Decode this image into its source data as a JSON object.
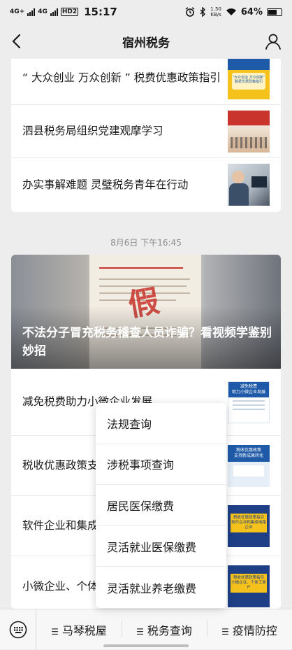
{
  "status": {
    "signal1": "4G+",
    "signal2": "4G",
    "hd": "HD2",
    "time": "15:17",
    "speed_value": "1.50",
    "speed_unit": "KB/s",
    "battery": "64%"
  },
  "header": {
    "title": "宿州税务"
  },
  "top_articles": [
    {
      "title": "“ 大众创业 万众创新 ” 税费优惠政策指引",
      "thumb_caption": "“大众创业 万众创新” 税费优惠政策指引"
    },
    {
      "title": "泗县税务局组织党建观摩学习"
    },
    {
      "title": "办实事解难题 灵璧税务青年在行动"
    }
  ],
  "timestamp": "8月6日 下午16:45",
  "cover": {
    "headline": "不法分子冒充税务稽查人员诈骗？看视频学鉴别妙招",
    "stamp": "假"
  },
  "articles": [
    {
      "title": "减免税费助力小微企业发展",
      "thumb_title": "减免税费",
      "thumb_sub": "助力小微企业发展"
    },
    {
      "title": "税收优惠政策支",
      "thumb_title": "税收优惠政策",
      "thumb_sub": "支持新成果转化"
    },
    {
      "title": "软件企业和集成指引",
      "thumb_title": "税收优惠政策指引",
      "thumb_sub": "软件企业和集成电路企业"
    },
    {
      "title": "小微企业、个体引",
      "thumb_title": "税收优惠政策指引",
      "thumb_sub": "小微企业、个体工商户"
    }
  ],
  "popup_menu": [
    "法规查询",
    "涉税事项查询",
    "居民医保缴费",
    "灵活就业医保缴费",
    "灵活就业养老缴费"
  ],
  "bottom_menu": [
    "马琴税屋",
    "税务查询",
    "疫情防控"
  ],
  "colors": {
    "accent": "#c8332b",
    "thumb_blue": "#1e5aa8",
    "thumb_yellow": "#f4c21b",
    "background": "#ededed"
  }
}
